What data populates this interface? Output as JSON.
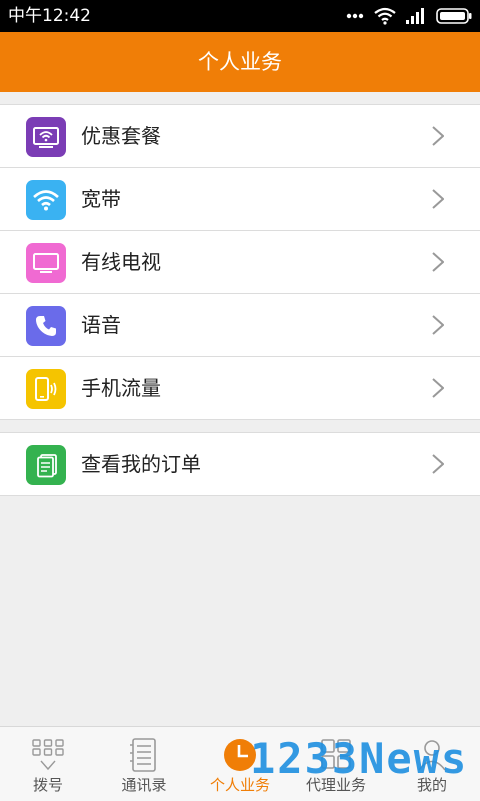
{
  "status_bar": {
    "time": "中午12:42"
  },
  "header": {
    "title": "个人业务"
  },
  "menu": {
    "items": [
      {
        "label": "优惠套餐",
        "icon": "tv-wifi-icon",
        "color": "#7b3db5"
      },
      {
        "label": "宽带",
        "icon": "wifi-icon",
        "color": "#3ab2f2"
      },
      {
        "label": "有线电视",
        "icon": "tv-icon",
        "color": "#f06ad2"
      },
      {
        "label": "语音",
        "icon": "phone-icon",
        "color": "#6a6bea"
      },
      {
        "label": "手机流量",
        "icon": "mobile-data-icon",
        "color": "#f5c400"
      }
    ],
    "order": {
      "label": "查看我的订单",
      "icon": "orders-icon",
      "color": "#34b24f"
    }
  },
  "tabbar": {
    "tabs": [
      {
        "label": "拨号",
        "icon": "dialpad-icon"
      },
      {
        "label": "通讯录",
        "icon": "contacts-icon"
      },
      {
        "label": "个人业务",
        "icon": "clock-icon",
        "active": true
      },
      {
        "label": "代理业务",
        "icon": "agent-icon"
      },
      {
        "label": "我的",
        "icon": "profile-icon"
      }
    ],
    "accent": "#f07e07"
  },
  "watermark": "1233News"
}
